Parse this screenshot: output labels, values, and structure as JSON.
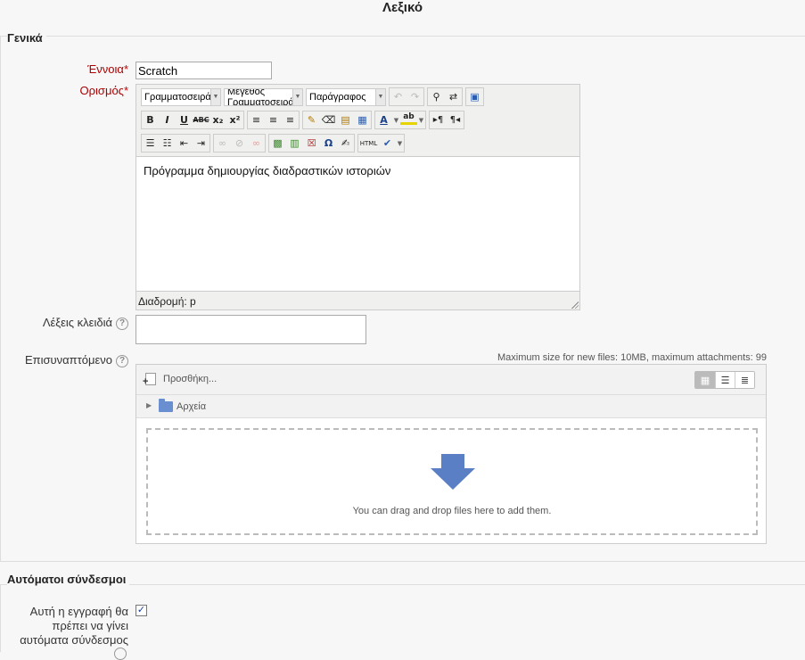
{
  "page": {
    "title": "Λεξικό"
  },
  "sections": {
    "general": "Γενικά",
    "autolink": "Αυτόματοι σύνδεσμοι"
  },
  "concept": {
    "label": "Έννοια",
    "required_mark": "*",
    "value": "Scratch"
  },
  "definition": {
    "label": "Ορισμός",
    "required_mark": "*",
    "font_family_select": "Γραμματοσειρά",
    "font_size_select": "Μέγεθος Γραμματοσειράς",
    "format_select": "Παράγραφος",
    "content": "Πρόγραμμα δημιουργίας διαδραστικών ιστοριών",
    "path_label": "Διαδρομή: p"
  },
  "keywords": {
    "label": "Λέξεις κλειδιά",
    "help": "?",
    "value": ""
  },
  "attachment": {
    "label": "Επισυναπτόμενο",
    "help": "?",
    "max_size_note": "Maximum size for new files: 10MB, maximum attachments: 99",
    "add_label": "Προσθήκη...",
    "folder_label": "Αρχεία",
    "drop_hint": "You can drag and drop files here to add them."
  },
  "autolink": {
    "entry_label": "Αυτή η εγγραφή θα πρέπει να γίνει αυτόματα σύνδεσμος",
    "checked": true,
    "check_mark": "✓"
  },
  "icons": {
    "dropdown": "▼",
    "folder_toggle": "▶",
    "help": "?"
  },
  "colors": {
    "required": "#aa0000",
    "accent": "#5b7fc4",
    "background": "#f7f7f7"
  }
}
